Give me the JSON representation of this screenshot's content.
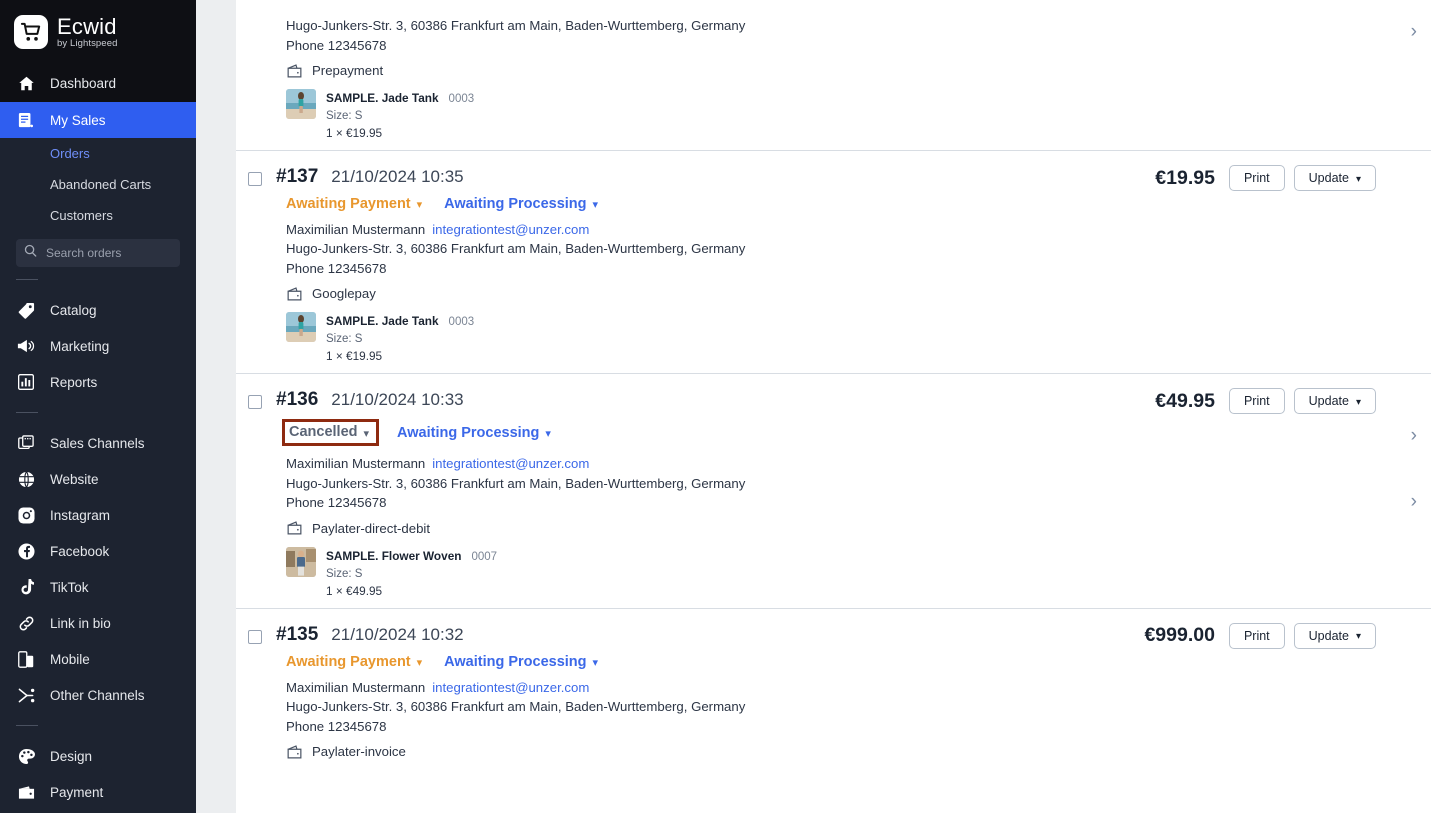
{
  "sidebar": {
    "brand": {
      "name": "Ecwid",
      "sub": "by Lightspeed"
    },
    "dashboard": {
      "label": "Dashboard",
      "icon": "home-icon"
    },
    "my_sales": {
      "label": "My Sales",
      "icon": "receipt-icon"
    },
    "sub_items": [
      {
        "label": "Orders",
        "selected": true
      },
      {
        "label": "Abandoned Carts",
        "selected": false
      },
      {
        "label": "Customers",
        "selected": false
      }
    ],
    "search": {
      "placeholder": "Search orders",
      "value": "",
      "icon": "search-icon"
    },
    "group_main": [
      {
        "label": "Catalog",
        "icon": "tag-icon"
      },
      {
        "label": "Marketing",
        "icon": "megaphone-icon"
      },
      {
        "label": "Reports",
        "icon": "bar-chart-icon"
      }
    ],
    "group_channels": [
      {
        "label": "Sales Channels",
        "icon": "storefront-icon"
      },
      {
        "label": "Website",
        "icon": "globe-icon"
      },
      {
        "label": "Instagram",
        "icon": "instagram-icon"
      },
      {
        "label": "Facebook",
        "icon": "facebook-icon"
      },
      {
        "label": "TikTok",
        "icon": "tiktok-icon"
      },
      {
        "label": "Link in bio",
        "icon": "link-icon"
      },
      {
        "label": "Mobile",
        "icon": "mobile-icon"
      },
      {
        "label": "Other Channels",
        "icon": "share-icon"
      }
    ],
    "group_settings": [
      {
        "label": "Design",
        "icon": "palette-icon"
      },
      {
        "label": "Payment",
        "icon": "wallet-icon"
      }
    ],
    "colors": {
      "bg": "#1d2330",
      "active": "#2f5ef0",
      "logo_bg": "#0e0f14",
      "sub_selected": "#6f8ef7"
    }
  },
  "buttons": {
    "print": "Print",
    "update": "Update",
    "chevron": "⌄"
  },
  "highlight": {
    "color": "#8e2a10",
    "target": "Cancelled"
  },
  "orders": [
    {
      "partial": true,
      "id": "",
      "date": "",
      "statuses": [],
      "customer_name": "",
      "customer_email": "",
      "address": "Hugo-Junkers-Str. 3, 60386 Frankfurt am Main, Baden-Wurttemberg, Germany",
      "phone": "Phone 12345678",
      "payment_method": "Prepayment",
      "price": "",
      "item": {
        "title": "SAMPLE. Jade Tank",
        "sku": "0003",
        "option": "Size: S",
        "qty": "1 × €19.95"
      }
    },
    {
      "partial": false,
      "id": "#137",
      "date": "21/10/2024 10:35",
      "statuses": [
        {
          "label": "Awaiting Payment",
          "kind": "awaiting-payment",
          "highlighted": false
        },
        {
          "label": "Awaiting Processing",
          "kind": "processing",
          "highlighted": false
        }
      ],
      "customer_name": "Maximilian Mustermann",
      "customer_email": "integrationtest@unzer.com",
      "address": "Hugo-Junkers-Str. 3, 60386 Frankfurt am Main, Baden-Wurttemberg, Germany",
      "phone": "Phone 12345678",
      "payment_method": "Googlepay",
      "price": "€19.95",
      "item": {
        "title": "SAMPLE. Jade Tank",
        "sku": "0003",
        "option": "Size: S",
        "qty": "1 × €19.95"
      }
    },
    {
      "partial": false,
      "id": "#136",
      "date": "21/10/2024 10:33",
      "statuses": [
        {
          "label": "Cancelled",
          "kind": "cancelled",
          "highlighted": true
        },
        {
          "label": "Awaiting Processing",
          "kind": "processing",
          "highlighted": false
        }
      ],
      "customer_name": "Maximilian Mustermann",
      "customer_email": "integrationtest@unzer.com",
      "address": "Hugo-Junkers-Str. 3, 60386 Frankfurt am Main, Baden-Wurttemberg, Germany",
      "phone": "Phone 12345678",
      "payment_method": "Paylater-direct-debit",
      "price": "€49.95",
      "item": {
        "title": "SAMPLE. Flower Woven",
        "sku": "0007",
        "option": "Size: S",
        "qty": "1 × €49.95"
      }
    },
    {
      "partial": false,
      "id": "#135",
      "date": "21/10/2024 10:32",
      "statuses": [
        {
          "label": "Awaiting Payment",
          "kind": "awaiting-payment",
          "highlighted": false
        },
        {
          "label": "Awaiting Processing",
          "kind": "processing",
          "highlighted": false
        }
      ],
      "customer_name": "Maximilian Mustermann",
      "customer_email": "integrationtest@unzer.com",
      "address": "Hugo-Junkers-Str. 3, 60386 Frankfurt am Main, Baden-Wurttemberg, Germany",
      "phone": "Phone 12345678",
      "payment_method": "Paylater-invoice",
      "price": "€999.00",
      "item": null
    }
  ]
}
